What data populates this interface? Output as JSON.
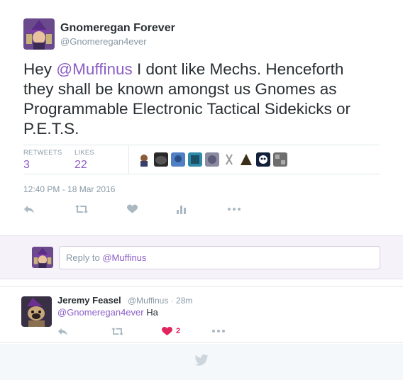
{
  "tweet": {
    "author_name": "Gnomeregan Forever",
    "author_handle": "@Gnomeregan4ever",
    "text_prefix": "Hey ",
    "text_mention": "@Muffinus",
    "text_suffix": " I dont like Mechs. Henceforth they shall be known amongst us Gnomes as Programmable Electronic Tactical Sidekicks or P.E.T.S.",
    "retweets_label": "RETWEETS",
    "retweets_count": "3",
    "likes_label": "LIKES",
    "likes_count": "22",
    "timestamp": "12:40 PM - 18 Mar 2016",
    "accent_color": "#8b5fc7"
  },
  "reply_box": {
    "prefix": "Reply to ",
    "mention": "@Muffinus"
  },
  "reply": {
    "author_name": "Jeremy Feasel",
    "author_handle": "@Muffinus",
    "separator": "·",
    "age": "28m",
    "mention": "@Gnomeregan4ever",
    "text": " Ha",
    "like_count": "2",
    "like_color": "#e0245e"
  },
  "icons": [
    "reply-icon",
    "retweet-icon",
    "heart-icon",
    "analytics-icon",
    "more-icon",
    "twitter-bird-icon"
  ]
}
